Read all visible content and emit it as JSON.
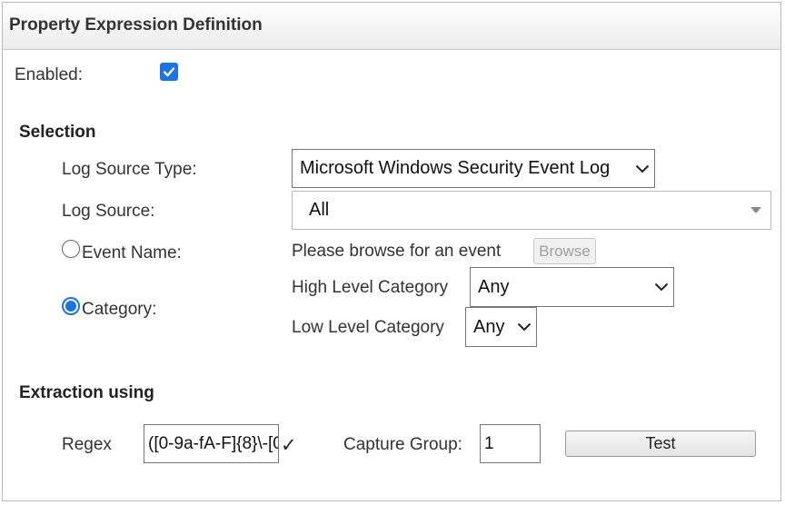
{
  "header": {
    "title": "Property Expression Definition"
  },
  "enabled": {
    "label": "Enabled:",
    "checked": true
  },
  "selection": {
    "title": "Selection",
    "log_source_type_label": "Log Source Type:",
    "log_source_type_value": "Microsoft Windows Security Event Log",
    "log_source_label": "Log Source:",
    "log_source_value": "All",
    "event_name_label": "Event Name:",
    "event_browse_prompt": "Please browse for an event",
    "browse_label": "Browse",
    "category_label": "Category:",
    "high_level_label": "High Level Category",
    "high_level_value": "Any",
    "low_level_label": "Low Level Category",
    "low_level_value": "Any"
  },
  "extraction": {
    "title": "Extraction using",
    "regex_label": "Regex",
    "regex_value": "([0-9a-fA-F]{8}\\-[0",
    "valid_mark": "✓",
    "capture_group_label": "Capture Group:",
    "capture_group_value": "1",
    "test_label": "Test"
  },
  "colors": {
    "accent": "#1a73e8",
    "border": "#767676"
  }
}
